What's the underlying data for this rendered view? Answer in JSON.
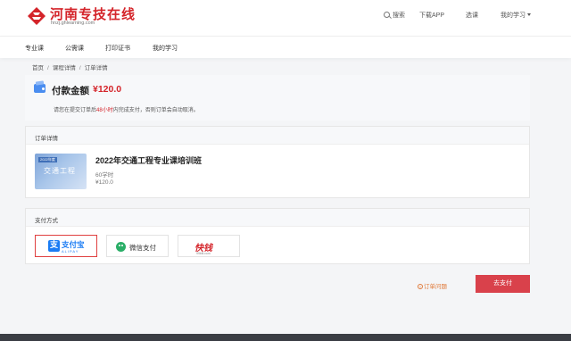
{
  "header": {
    "logo_title": "河南专技在线",
    "logo_url": "hnzj.ghlearning.com",
    "search_label": "搜索",
    "download_label": "下载APP",
    "select_course_label": "选课",
    "my_learning_label": "我的学习"
  },
  "menu": {
    "items": [
      "专业课",
      "公需课",
      "打印证书",
      "我的学习"
    ]
  },
  "breadcrumb": {
    "items": [
      "首页",
      "课程详情",
      "订单详情"
    ],
    "separator": "/"
  },
  "payment": {
    "label": "付款金额",
    "amount": "¥120.0",
    "note_before": "请您在提交订单后",
    "note_highlight": "48小时",
    "note_after": "内完成支付，否则订单会自动取消。"
  },
  "order": {
    "section_title": "订单详情",
    "thumb_tag": "2022年度",
    "thumb_text": "交通工程",
    "course_title": "2022年交通工程专业课培训班",
    "hours": "60学时",
    "price": "¥120.0"
  },
  "pay_methods": {
    "section_title": "支付方式",
    "alipay_glyph": "支",
    "alipay_name": "支付宝",
    "alipay_sub": "ALIPAY",
    "wechat_name": "微信支付",
    "kuaiqian_name": "快钱",
    "kuaiqian_sub": "99bill.com",
    "selected": "alipay"
  },
  "actions": {
    "issue_icon": "!",
    "issue_label": "订单问题",
    "pay_button": "去支付"
  },
  "colors": {
    "brand_red": "#d4242a",
    "pay_button": "#d9414b",
    "alipay_blue": "#1a7cf4",
    "wechat_green": "#2aae67"
  },
  "icons": [
    "search-icon",
    "caret-down-icon",
    "wallet-icon",
    "alipay-icon",
    "wechat-icon",
    "warning-icon"
  ]
}
